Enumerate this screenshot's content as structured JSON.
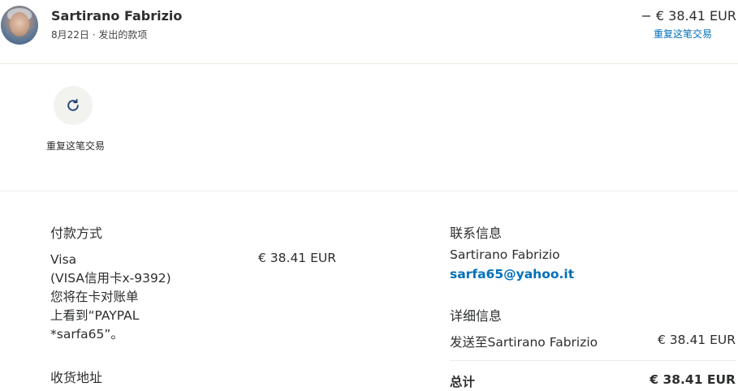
{
  "header": {
    "name": "Sartirano Fabrizio",
    "subline": "8月22日 · 发出的款项",
    "amount": "− € 38.41 EUR",
    "repeat_link": "重复这笔交易"
  },
  "repeat_action": {
    "label": "重复这笔交易",
    "icon": "refresh-icon"
  },
  "payment": {
    "heading": "付款方式",
    "lines": [
      "Visa",
      "(VISA信用卡x-9392)",
      "您将在卡对账单",
      "上看到“PAYPAL",
      "*sarfa65”。"
    ],
    "amount": "€ 38.41 EUR"
  },
  "shipping": {
    "heading": "收货地址"
  },
  "contact": {
    "heading": "联系信息",
    "name": "Sartirano Fabrizio",
    "email": "sarfa65@yahoo.it"
  },
  "details": {
    "heading": "详细信息",
    "sent_to": "发送至Sartirano Fabrizio",
    "sent_amount": "€ 38.41 EUR",
    "total_label": "总计",
    "total_amount": "€ 38.41 EUR"
  },
  "colors": {
    "link": "#0070ba",
    "text": "#2c2e2f",
    "button_bg": "#f2f2ef"
  }
}
